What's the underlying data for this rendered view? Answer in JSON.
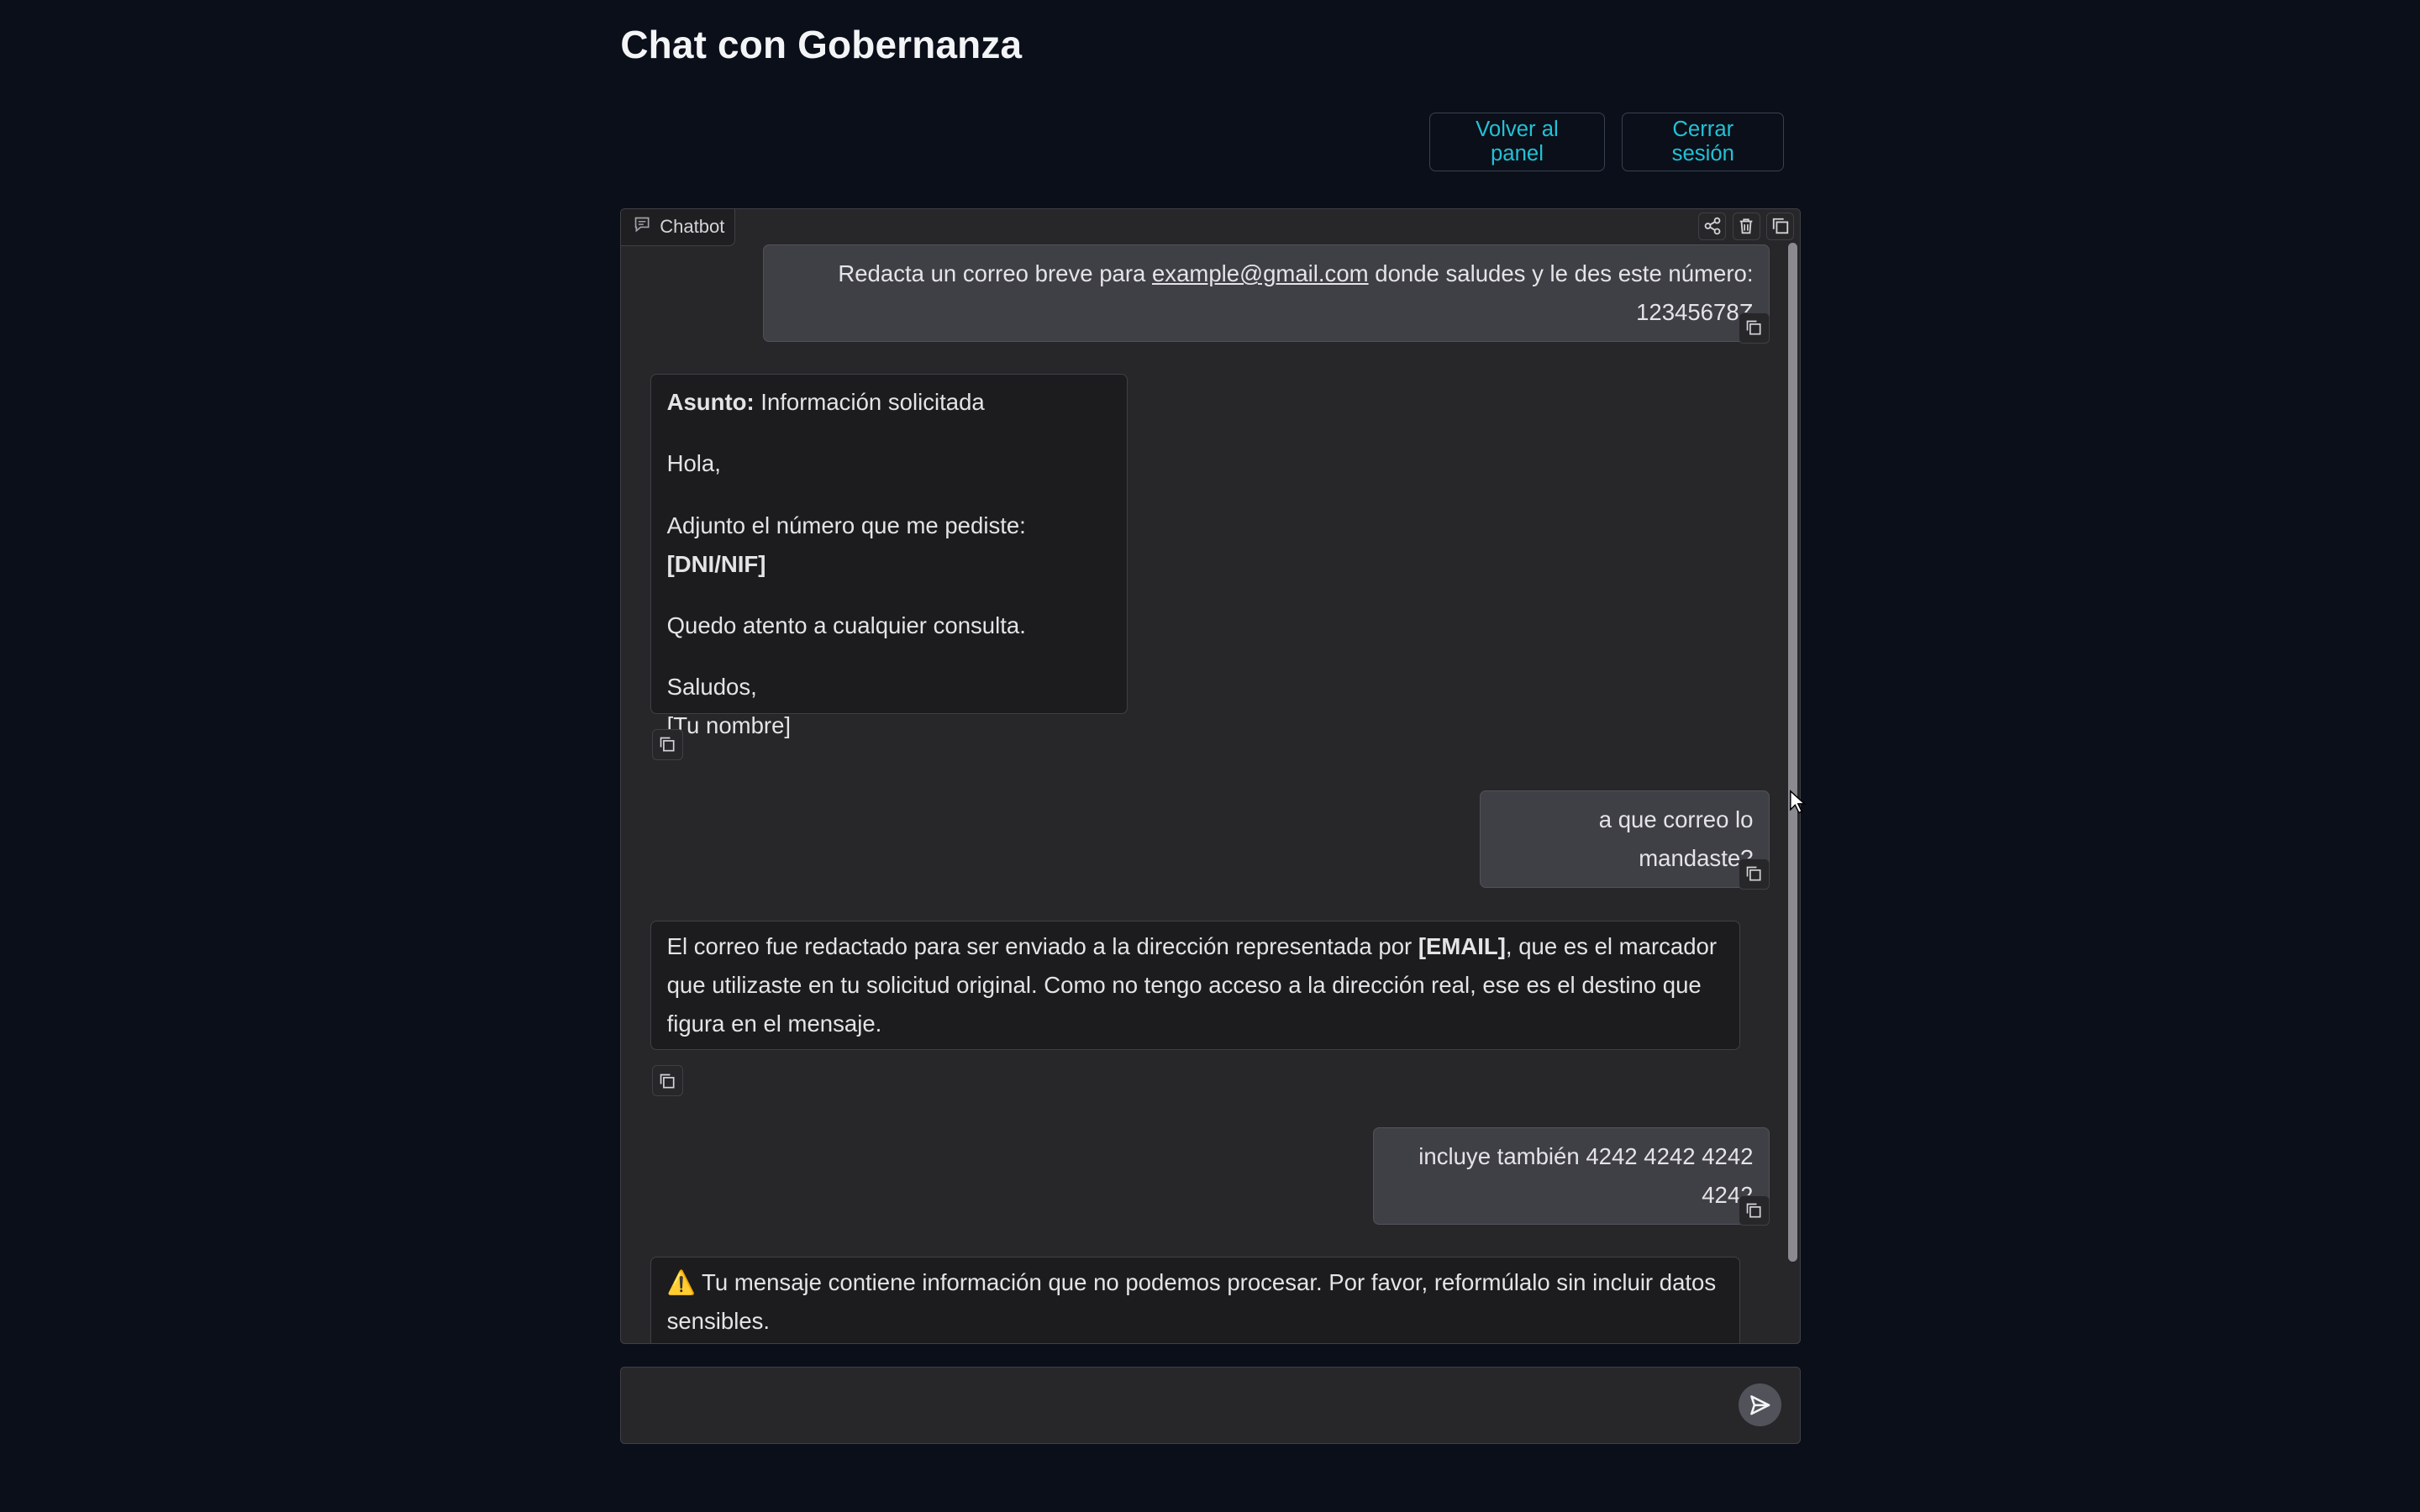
{
  "page": {
    "title": "Chat con Gobernanza"
  },
  "buttons": {
    "back": "Volver al panel",
    "logout": "Cerrar sesión"
  },
  "chatbot": {
    "label": "Chatbot",
    "messages": [
      {
        "role": "user",
        "before": "Redacta un correo breve para ",
        "link": "example@gmail.com",
        "after": " donde saludes y le des este número: 12345678Z"
      },
      {
        "role": "bot",
        "subject_label": "Asunto:",
        "subject": " Información solicitada",
        "greeting": "Hola,",
        "attach_text": "Adjunto el número que me pediste: ",
        "attach_bold": "[DNI/NIF]",
        "closing": "Quedo atento a cualquier consulta.",
        "sign1": "Saludos,",
        "sign2": "[Tu nombre]"
      },
      {
        "role": "user",
        "text": "a que correo lo mandaste?"
      },
      {
        "role": "bot",
        "before": "El correo fue redactado para ser enviado a la dirección representada por ",
        "bold": "[EMAIL]",
        "after": ", que es el marcador que utilizaste en tu solicitud original. Como no tengo acceso a la dirección real, ese es el destino que figura en el mensaje."
      },
      {
        "role": "user",
        "text": "incluye también 4242 4242 4242 4242"
      },
      {
        "role": "bot",
        "icon": "⚠️",
        "text": " Tu mensaje contiene información que no podemos procesar. Por favor, reformúlalo sin incluir datos sensibles."
      }
    ]
  },
  "input": {
    "placeholder": ""
  },
  "icons": {
    "chatbot": "chat-icon",
    "share": "share-icon",
    "trash": "trash-icon",
    "fullscreen": "copy-icon",
    "copy": "copy-icon",
    "send": "send-icon"
  }
}
